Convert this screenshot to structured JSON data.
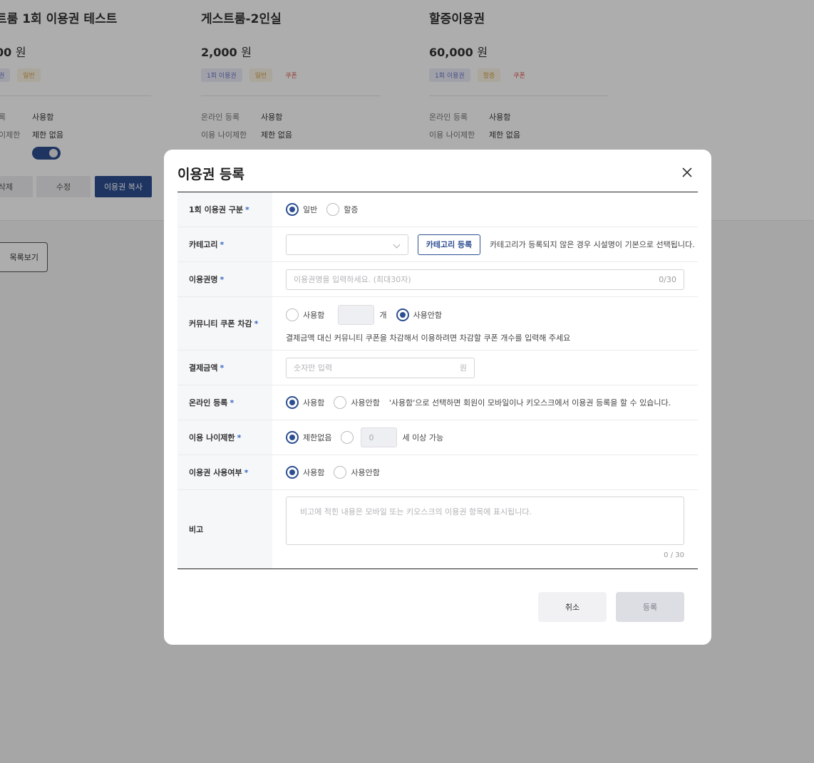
{
  "background": {
    "cards": [
      {
        "title": "트룸 1회 이용권 테스트",
        "price": "00",
        "price_unit": "원",
        "tags": [
          "권",
          "일반"
        ],
        "online_label": "록",
        "online_value": "사용함",
        "age_label": "이제한",
        "age_value": "제한 없음",
        "delete_label": "삭제",
        "edit_label": "수정",
        "copy_label": "이용권 복사"
      },
      {
        "title": "게스트룸-2인실",
        "price": "2,000",
        "price_unit": "원",
        "tags": [
          "1회 이용권",
          "일반",
          "쿠폰"
        ],
        "online_label": "온라인 등록",
        "online_value": "사용함",
        "age_label": "이용 나이제한",
        "age_value": "제한 없음"
      },
      {
        "title": "할증이용권",
        "price": "60,000",
        "price_unit": "원",
        "tags": [
          "1회 이용권",
          "할증",
          "쿠폰"
        ],
        "online_label": "온라인 등록",
        "online_value": "사용함",
        "age_label": "이용 나이제한",
        "age_value": "제한 없음"
      }
    ],
    "list_button": "목록보기"
  },
  "modal": {
    "title": "이용권 등록",
    "rows": {
      "type": {
        "label": "1회 이용권 구분",
        "options": [
          "일반",
          "할증"
        ],
        "selected": "일반"
      },
      "category": {
        "label": "카테고리",
        "button": "카테고리 등록",
        "hint": "카테고리가 등록되지 않은 경우 시설명이 기본으로 선택됩니다."
      },
      "name": {
        "label": "이용권명",
        "placeholder": "이용권명을 입력하세요. (최대30자)",
        "counter": "0/30"
      },
      "coupon": {
        "label": "커뮤니티 쿠폰 차감",
        "use_label": "사용함",
        "unit": "개",
        "not_use_label": "사용안함",
        "selected": "사용안함",
        "help": "결제금액 대신 커뮤니티 쿠폰을 차감해서 이용하려면 차감할 쿠폰 개수를 입력해 주세요"
      },
      "price": {
        "label": "결제금액",
        "placeholder": "숫자만 입력",
        "unit": "원"
      },
      "online": {
        "label": "온라인 등록",
        "options": [
          "사용함",
          "사용안함"
        ],
        "selected": "사용함",
        "note": "'사용함'으로 선택하면 회원이 모바일이나 키오스크에서 이용권 등록을 할 수 있습니다."
      },
      "age": {
        "label": "이용 나이제한",
        "no_limit_label": "제한없음",
        "age_value": "0",
        "age_suffix": "세 이상 가능",
        "selected": "제한없음"
      },
      "usage": {
        "label": "이용권 사용여부",
        "options": [
          "사용함",
          "사용안함"
        ],
        "selected": "사용함"
      },
      "memo": {
        "label": "비고",
        "placeholder": "비고에 적힌 내용은 모바일 또는 키오스크의 이용권 항목에 표시됩니다.",
        "counter": "0 / 30"
      }
    },
    "required_mark": "*",
    "cancel_label": "취소",
    "submit_label": "등록"
  },
  "colors": {
    "primary": "#2d4f91",
    "required": "#3d6bc6",
    "overlay": "rgba(0,0,0,0.32)"
  }
}
